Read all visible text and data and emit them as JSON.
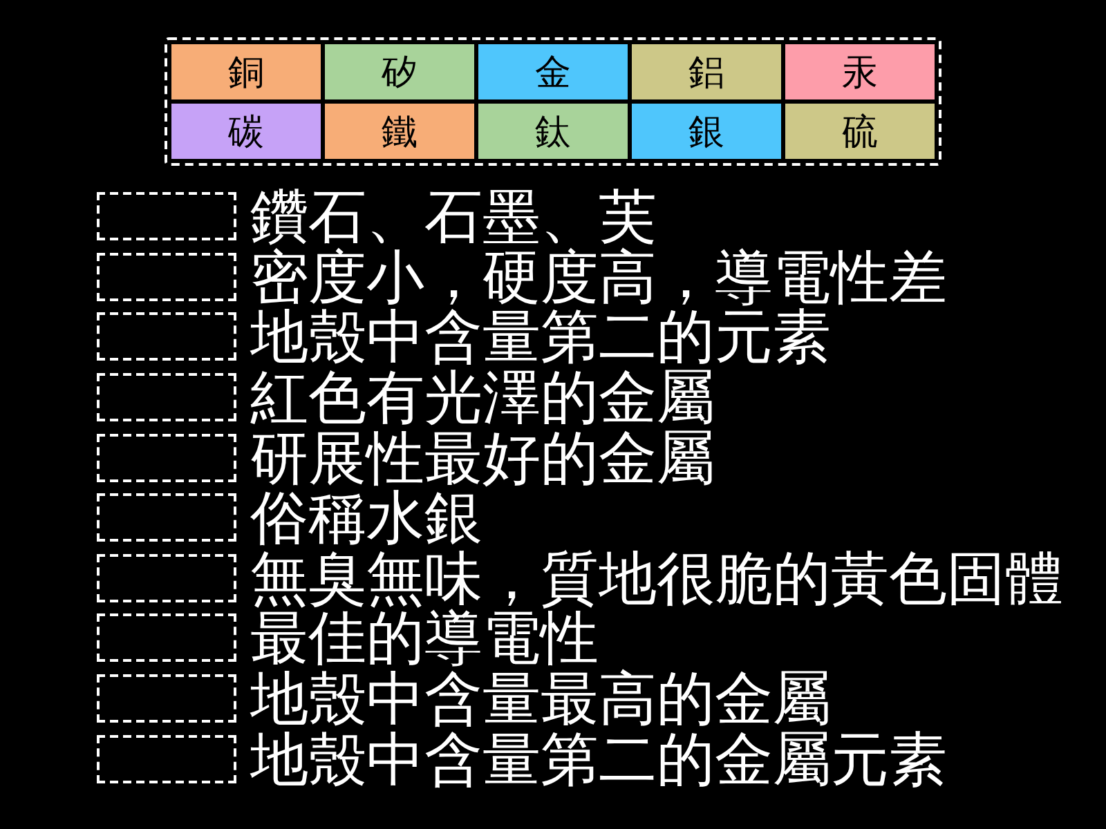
{
  "word_bank": [
    {
      "label": "銅",
      "color": "#f7ad77"
    },
    {
      "label": "矽",
      "color": "#a8d39a"
    },
    {
      "label": "金",
      "color": "#4fc6fc"
    },
    {
      "label": "鋁",
      "color": "#cdc888"
    },
    {
      "label": "汞",
      "color": "#fd9daa"
    },
    {
      "label": "碳",
      "color": "#c6a2f7"
    },
    {
      "label": "鐵",
      "color": "#f7ad77"
    },
    {
      "label": "鈦",
      "color": "#a8d39a"
    },
    {
      "label": "銀",
      "color": "#4fc6fc"
    },
    {
      "label": "硫",
      "color": "#cdc888"
    }
  ],
  "clues": [
    {
      "text": "鑽石、石墨、芙"
    },
    {
      "text": "密度小，硬度高，導電性差"
    },
    {
      "text": "地殼中含量第二的元素"
    },
    {
      "text": "紅色有光澤的金屬"
    },
    {
      "text": "研展性最好的金屬"
    },
    {
      "text": "俗稱水銀"
    },
    {
      "text": "無臭無味，質地很脆的黃色固體"
    },
    {
      "text": "最佳的導電性"
    },
    {
      "text": "地殼中含量最高的金屬"
    },
    {
      "text": "地殼中含量第二的金屬元素"
    }
  ]
}
